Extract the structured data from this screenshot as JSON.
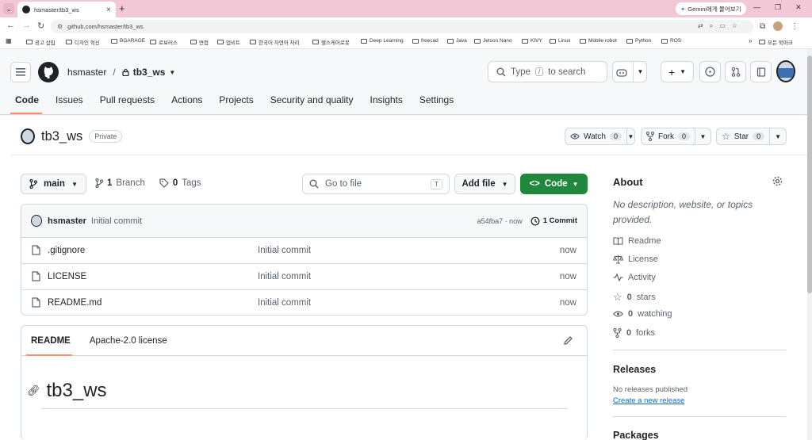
{
  "browser": {
    "tab_title": "hsmaster/tb3_ws",
    "url": "github.com/hsmaster/tb3_ws",
    "gemini_label": "Gemini에게 물어보기",
    "bookmarks": [
      "광고 삽입",
      "디자인 혁신",
      "BGARAGE",
      "로보러스",
      "면접",
      "업비트",
      "한국어 자연어 처리",
      "헬스케어로봇",
      "Deep Learning",
      "freecad",
      "Java",
      "Jetson Nano",
      "KIVY",
      "Linux",
      "Mobile robot",
      "Python",
      "ROS"
    ],
    "all_bookmarks": "모든 북마크"
  },
  "header": {
    "owner": "hsmaster",
    "separator": "/",
    "repo": "tb3_ws",
    "search_pre": "Type",
    "search_key": "/",
    "search_post": "to search"
  },
  "repo_nav": [
    "Code",
    "Issues",
    "Pull requests",
    "Actions",
    "Projects",
    "Security and quality",
    "Insights",
    "Settings"
  ],
  "repo": {
    "name": "tb3_ws",
    "visibility": "Private",
    "watch_label": "Watch",
    "watch_count": "0",
    "fork_label": "Fork",
    "fork_count": "0",
    "star_label": "Star",
    "star_count": "0"
  },
  "branchbar": {
    "branch": "main",
    "branch_count": "1",
    "branch_label": "Branch",
    "tag_count": "0",
    "tag_label": "Tags",
    "gofile_placeholder": "Go to file",
    "gofile_key": "T",
    "addfile_label": "Add file",
    "code_label": "Code"
  },
  "commit": {
    "user": "hsmaster",
    "message": "Initial commit",
    "sha_time": "a54fba7 · now",
    "count_label": "1 Commit"
  },
  "files": [
    {
      "name": ".gitignore",
      "message": "Initial commit",
      "age": "now"
    },
    {
      "name": "LICENSE",
      "message": "Initial commit",
      "age": "now"
    },
    {
      "name": "README.md",
      "message": "Initial commit",
      "age": "now"
    }
  ],
  "readme": {
    "tab_readme": "README",
    "tab_license": "Apache-2.0 license",
    "heading": "tb3_ws"
  },
  "about": {
    "title": "About",
    "description": "No description, website, or topics provided.",
    "readme": "Readme",
    "license": "License",
    "activity": "Activity",
    "stars_count": "0",
    "stars_label": "stars",
    "watching_count": "0",
    "watching_label": "watching",
    "forks_count": "0",
    "forks_label": "forks"
  },
  "releases": {
    "title": "Releases",
    "none": "No releases published",
    "create_link": "Create a new release"
  },
  "packages": {
    "title": "Packages"
  },
  "colors": {
    "accent_green": "#1f883d",
    "nav_underline": "#fd8c73",
    "link": "#0969da",
    "tab_strip": "#f3c8d6"
  }
}
